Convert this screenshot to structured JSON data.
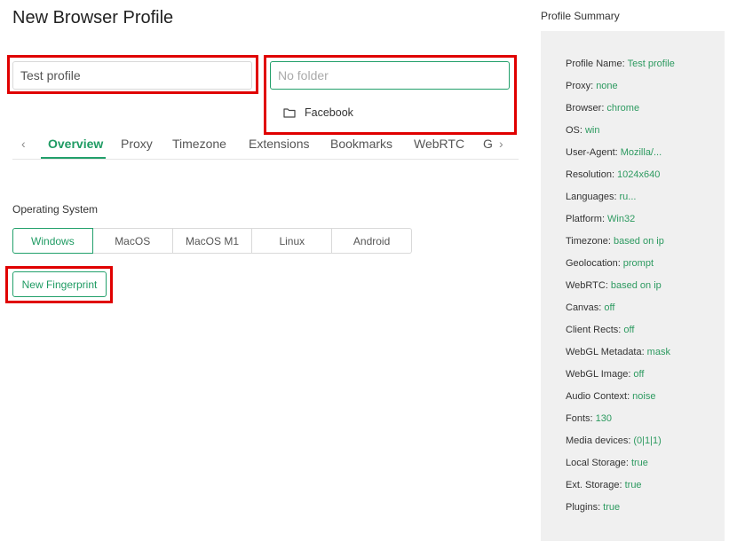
{
  "page": {
    "title": "New Browser Profile"
  },
  "form": {
    "name_value": "Test profile",
    "folder_placeholder": "No folder",
    "folder_options": [
      "Facebook"
    ]
  },
  "tabs": {
    "prev_icon": "chevron-left-icon",
    "next_icon": "chevron-right-icon",
    "items": [
      "Overview",
      "Proxy",
      "Timezone",
      "Extensions",
      "Bookmarks",
      "WebRTC",
      "G"
    ],
    "active": "Overview"
  },
  "os": {
    "label": "Operating System",
    "options": [
      "Windows",
      "MacOS",
      "MacOS M1",
      "Linux",
      "Android"
    ],
    "selected": "Windows"
  },
  "actions": {
    "new_fingerprint": "New Fingerprint"
  },
  "summary": {
    "title": "Profile Summary",
    "rows": [
      {
        "label": "Profile Name:",
        "value": "Test profile"
      },
      {
        "label": "Proxy:",
        "value": "none"
      },
      {
        "label": "Browser:",
        "value": "chrome"
      },
      {
        "label": "OS:",
        "value": "win"
      },
      {
        "label": "User-Agent:",
        "value": "Mozilla/..."
      },
      {
        "label": "Resolution:",
        "value": "1024x640"
      },
      {
        "label": "Languages:",
        "value": "ru..."
      },
      {
        "label": "Platform:",
        "value": "Win32"
      },
      {
        "label": "Timezone:",
        "value": "based on ip"
      },
      {
        "label": "Geolocation:",
        "value": "prompt"
      },
      {
        "label": "WebRTC:",
        "value": "based on ip"
      },
      {
        "label": "Canvas:",
        "value": "off"
      },
      {
        "label": "Client Rects:",
        "value": "off"
      },
      {
        "label": "WebGL Metadata:",
        "value": "mask"
      },
      {
        "label": "WebGL Image:",
        "value": "off"
      },
      {
        "label": "Audio Context:",
        "value": "noise"
      },
      {
        "label": "Fonts:",
        "value": "130"
      },
      {
        "label": "Media devices:",
        "value": "(0|1|1)"
      },
      {
        "label": "Local Storage:",
        "value": "true"
      },
      {
        "label": "Ext. Storage:",
        "value": "true"
      },
      {
        "label": "Plugins:",
        "value": "true"
      }
    ]
  },
  "colors": {
    "accent": "#22a06b",
    "highlight": "#e00000",
    "panel": "#f0f0f0"
  }
}
